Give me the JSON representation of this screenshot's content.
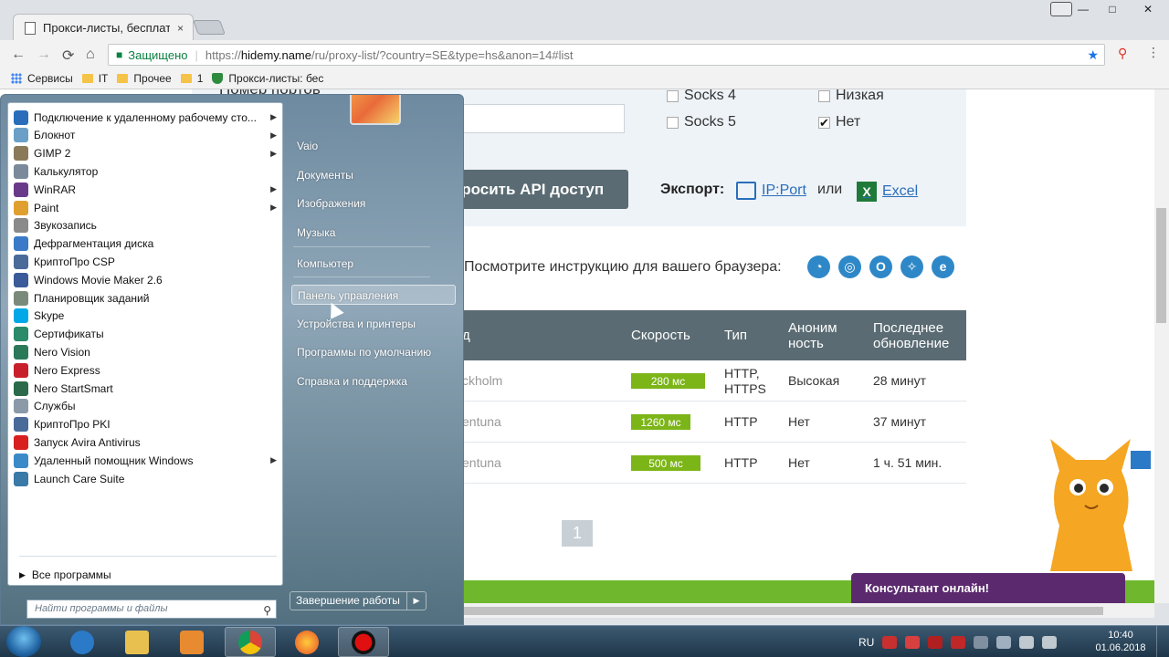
{
  "browser": {
    "tab_title": "Прокси-листы, бесплатн",
    "tab_close": "×",
    "window_buttons": [
      "—",
      "□",
      "✕"
    ],
    "omnibox": {
      "secure_label": "Защищено",
      "url_prefix": "https://",
      "url_host": "hidemy.name",
      "url_path": "/ru/proxy-list/?country=SE&type=hs&anon=14#list"
    },
    "bookmarks": [
      "Сервисы",
      "IT",
      "Прочее",
      "1",
      "Прокси-листы: бес"
    ]
  },
  "page": {
    "ports_label": "Номер портов",
    "socks4": "Socks 4",
    "socks5": "Socks 5",
    "anon_low": "Низкая",
    "anon_no": "Нет",
    "api_button": "Запросить API доступ",
    "export_label": "Экспорт:",
    "export_ipport": "IP:Port",
    "export_or": "или",
    "export_excel": "Excel",
    "browser_hint": "Посмотрите инструкцию для вашего браузера:",
    "table": {
      "headers": {
        "city": "д",
        "speed": "Скорость",
        "type": "Тип",
        "anon": "Аноним\nность",
        "updated": "Последнее\nобновление"
      },
      "rows": [
        {
          "city": "ckholm",
          "speed": "280 мс",
          "speed_fill": 0.75,
          "type": "HTTP,\nHTTPS",
          "anon": "Высокая",
          "updated": "28 минут"
        },
        {
          "city": "entuna",
          "speed": "1260 мс",
          "speed_fill": 0.6,
          "type": "HTTP",
          "anon": "Нет",
          "updated": "37 минут"
        },
        {
          "city": "entuna",
          "speed": "500 мс",
          "speed_fill": 0.7,
          "type": "HTTP",
          "anon": "Нет",
          "updated": "1 ч. 51 мин."
        }
      ]
    },
    "pager_current": "1",
    "consultant": "Консультант онлайн!"
  },
  "start_menu": {
    "programs": [
      {
        "label": "Подключение к удаленному рабочему сто...",
        "arrow": true,
        "color": "#2a6ebb"
      },
      {
        "label": "Блокнот",
        "arrow": true,
        "color": "#6aa0c8"
      },
      {
        "label": "GIMP 2",
        "arrow": true,
        "color": "#8a7a5a"
      },
      {
        "label": "Калькулятор",
        "arrow": false,
        "color": "#7a8a9a"
      },
      {
        "label": "WinRAR",
        "arrow": true,
        "color": "#6a3a8a"
      },
      {
        "label": "Paint",
        "arrow": true,
        "color": "#e0a030"
      },
      {
        "label": "Звукозапись",
        "arrow": false,
        "color": "#8a8a8a"
      },
      {
        "label": "Дефрагментация диска",
        "arrow": false,
        "color": "#3a7ac8"
      },
      {
        "label": "КриптоПро CSP",
        "arrow": false,
        "color": "#4a6a9a"
      },
      {
        "label": "Windows Movie Maker 2.6",
        "arrow": false,
        "color": "#3a5a9a"
      },
      {
        "label": "Планировщик заданий",
        "arrow": false,
        "color": "#7a8a7a"
      },
      {
        "label": "Skype",
        "arrow": false,
        "color": "#00a8e8"
      },
      {
        "label": "Сертификаты",
        "arrow": false,
        "color": "#2a8a6a"
      },
      {
        "label": "Nero Vision",
        "arrow": false,
        "color": "#2a7a5a"
      },
      {
        "label": "Nero Express",
        "arrow": false,
        "color": "#c8202a"
      },
      {
        "label": "Nero StartSmart",
        "arrow": false,
        "color": "#2a6a4a"
      },
      {
        "label": "Службы",
        "arrow": false,
        "color": "#8a9aa8"
      },
      {
        "label": "КриптоПро PKI",
        "arrow": false,
        "color": "#4a6a9a"
      },
      {
        "label": "Запуск Avira Antivirus",
        "arrow": false,
        "color": "#d82020"
      },
      {
        "label": "Удаленный помощник Windows",
        "arrow": true,
        "color": "#3a8ac8"
      },
      {
        "label": "Launch Care Suite",
        "arrow": false,
        "color": "#3a7aa8"
      }
    ],
    "all_programs": "Все программы",
    "search_placeholder": "Найти программы и файлы",
    "right": [
      "Vaio",
      "Документы",
      "Изображения",
      "Музыка",
      "Компьютер",
      "Панель управления",
      "Устройства и принтеры",
      "Программы по умолчанию",
      "Справка и поддержка"
    ],
    "right_highlight_index": 5,
    "shutdown": "Завершение работы"
  },
  "taskbar": {
    "lang": "RU",
    "time": "10:40",
    "date": "01.06.2018"
  }
}
